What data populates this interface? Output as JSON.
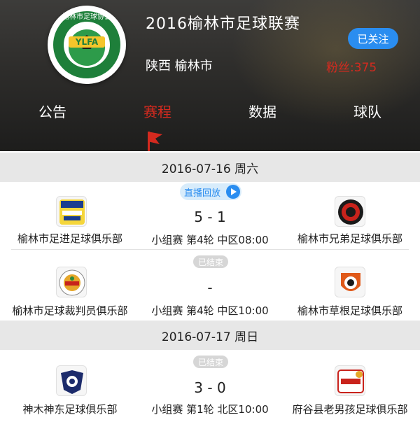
{
  "league": {
    "title": "2016榆林市足球联赛",
    "location": "陕西 榆林市",
    "follow_label": "已关注",
    "fans_label": "粉丝:375",
    "logo_text": "榆林市足球协会",
    "logo_abbr": "YLFA"
  },
  "tabs": [
    {
      "label": "公告"
    },
    {
      "label": "赛程"
    },
    {
      "label": "数据"
    },
    {
      "label": "球队"
    }
  ],
  "active_tab": "赛程",
  "colors": {
    "accent_red": "#d42a1f",
    "accent_blue": "#2a8df0",
    "date_bar": "#e7e7e7"
  },
  "schedule": [
    {
      "date": "2016-07-16 周六",
      "matches": [
        {
          "status": "直播回放",
          "home": "榆林市足进足球俱乐部",
          "away": "榆林市兄弟足球俱乐部",
          "score": "5 - 1",
          "round": "小组赛 第4轮 中区08:00"
        },
        {
          "status": "已结束",
          "home": "榆林市足球裁判员俱乐部",
          "away": "榆林市草根足球俱乐部",
          "score": "-",
          "round": "小组赛 第4轮 中区10:00"
        }
      ]
    },
    {
      "date": "2016-07-17 周日",
      "matches": [
        {
          "status": "已结束",
          "home": "神木神东足球俱乐部",
          "away": "府谷县老男孩足球俱乐部",
          "score": "3 - 0",
          "round": "小组赛 第1轮 北区10:00"
        }
      ]
    }
  ]
}
